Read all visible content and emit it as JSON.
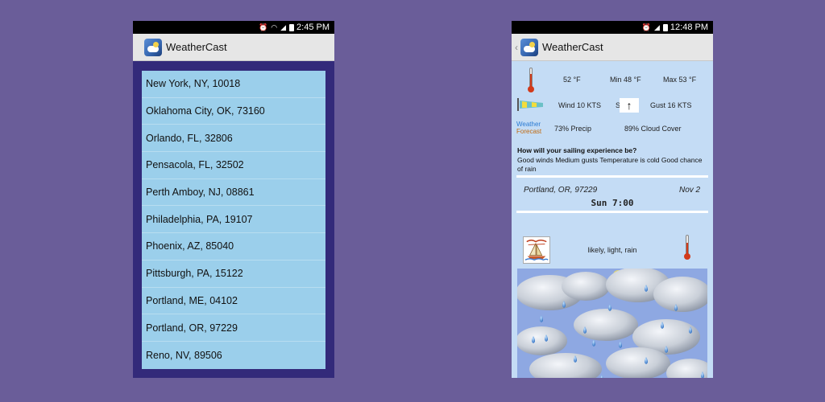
{
  "left_phone": {
    "status_time": "2:45 PM",
    "app_title": "WeatherCast",
    "locations": [
      "New York, NY, 10018",
      "Oklahoma City, OK, 73160",
      "Orlando, FL, 32806",
      "Pensacola, FL, 32502",
      "Perth Amboy, NJ, 08861",
      "Philadelphia, PA, 19107",
      "Phoenix, AZ, 85040",
      "Pittsburgh, PA, 15122",
      "Portland, ME, 04102",
      "Portland, OR, 97229",
      "Reno, NV, 89506"
    ]
  },
  "right_phone": {
    "status_time": "12:48 PM",
    "app_title": "WeatherCast",
    "temp": "52 °F",
    "min_temp": "Min 48 °F",
    "max_temp": "Max 53 °F",
    "wind": "Wind 10 KTS",
    "wind_dir": "S",
    "gust": "Gust 16 KTS",
    "logo_line1": "Weather",
    "logo_line2": "Forecast",
    "precip": "73% Precip",
    "cloud": "89% Cloud Cover",
    "question": "How will your sailing experience be?",
    "answer": "Good winds Medium gusts Temperature is cold Good chance of rain",
    "location": "Portland, OR, 97229",
    "date": "Nov 2",
    "time": "Sun 7:00",
    "conditions": "likely, light, rain"
  },
  "colors": {
    "background": "#6a5d99",
    "list_bg": "#9bcfeb",
    "list_frame": "#332a7a",
    "detail_bg": "#c4dcf5"
  },
  "icons": [
    "alarm-icon",
    "wifi-icon",
    "4g-icon",
    "signal-icon",
    "battery-icon",
    "app-icon",
    "back-chevron-icon",
    "thermometer-icon",
    "windsock-icon",
    "arrow-up-icon",
    "sailboat-icon",
    "rain-clouds-image"
  ]
}
